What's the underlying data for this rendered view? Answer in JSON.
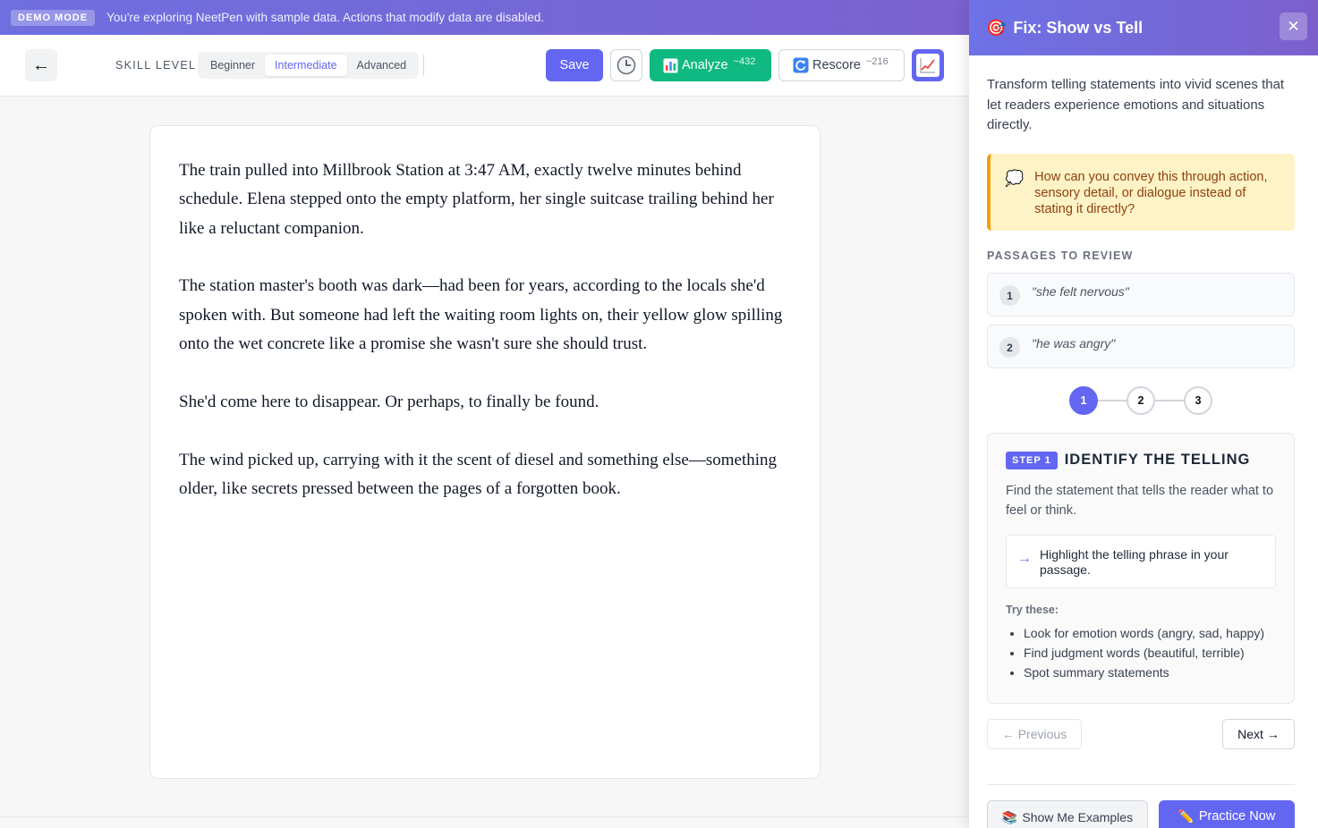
{
  "banner": {
    "badge": "DEMO MODE",
    "message": "You're exploring NeetPen with sample data. Actions that modify data are disabled."
  },
  "toolbar": {
    "back_icon": "←",
    "skill_label": "SKILL LEVEL",
    "skill_levels": [
      "Beginner",
      "Intermediate",
      "Advanced"
    ],
    "selected_skill": "Intermediate",
    "save_label": "Save",
    "analyze_label": "Analyze",
    "analyze_cost": "~432",
    "rescore_label": "Rescore",
    "rescore_cost": "~216",
    "colors": {
      "save": "#6366f1",
      "analyze": "#10b981",
      "chart": "#6366f1"
    }
  },
  "editor": {
    "paragraphs": [
      "The train pulled into Millbrook Station at 3:47 AM, exactly twelve minutes behind schedule. Elena stepped onto the empty platform, her single suitcase trailing behind her like a reluctant companion.",
      "The station master's booth was dark—had been for years, according to the locals she'd spoken with. But someone had left the waiting room lights on, their yellow glow spilling onto the wet concrete like a promise she wasn't sure she should trust.",
      "She'd come here to disappear. Or perhaps, to finally be found.",
      "The wind picked up, carrying with it the scent of diesel and something else—something older, like secrets pressed between the pages of a forgotten book."
    ]
  },
  "panel": {
    "title_icon": "🎯",
    "title": "Fix: Show vs Tell",
    "close_icon": "✕",
    "description": "Transform telling statements into vivid scenes that let readers experience emotions and situations directly.",
    "hint_icon": "💭",
    "hint": "How can you convey this through action, sensory detail, or dialogue instead of stating it directly?",
    "passages_label": "PASSAGES TO REVIEW",
    "passages": [
      {
        "num": "1",
        "text": "\"she felt nervous\""
      },
      {
        "num": "2",
        "text": "\"he was angry\""
      }
    ],
    "steps": [
      "1",
      "2",
      "3"
    ],
    "current_step": "1",
    "step_badge": "STEP 1",
    "step_title": "IDENTIFY THE TELLING",
    "step_desc": "Find the statement that tells the reader what to feel or think.",
    "action_icon": "→",
    "action_text": "Highlight the telling phrase in your passage.",
    "try_label": "Try these:",
    "tips": [
      "Look for emotion words (angry, sad, happy)",
      "Find judgment words (beautiful, terrible)",
      "Spot summary statements"
    ],
    "prev_label": "← Previous",
    "next_label": "Next →",
    "examples_icon": "📚",
    "examples_label": "Show Me Examples",
    "practice_icon": "✏️",
    "practice_label": "Practice Now"
  }
}
